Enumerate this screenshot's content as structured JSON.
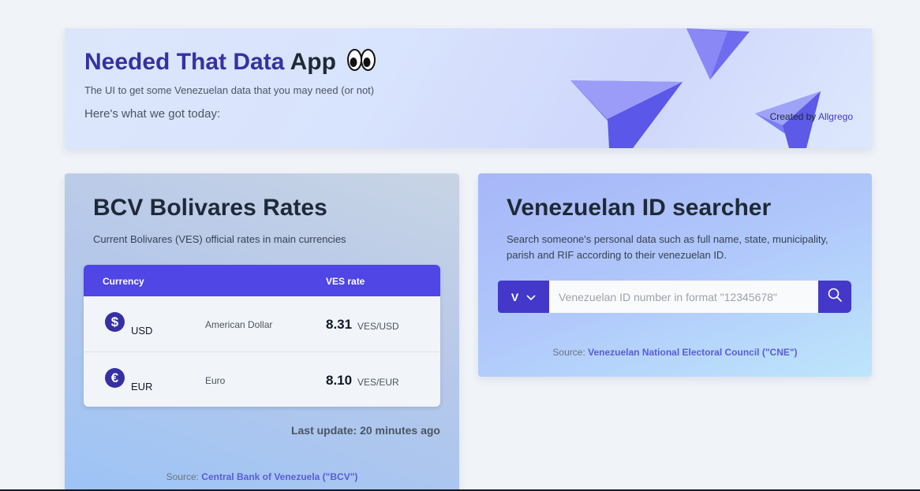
{
  "header": {
    "title_accent": "Needed That Data",
    "title_plain": "App",
    "subtitle": "The UI to get some Venezuelan data that you may need (or not)",
    "today": "Here's what we got today:",
    "credit_prefix": "Created by",
    "credit_link": "Allgrego"
  },
  "bcv": {
    "title": "BCV Bolivares Rates",
    "description": "Current Bolivares (VES) official rates in main currencies",
    "table": {
      "col_currency": "Currency",
      "col_rate": "VES rate",
      "rows": [
        {
          "symbol": "$",
          "code": "USD",
          "name": "American Dollar",
          "rate": "8.31",
          "unit": "VES/USD"
        },
        {
          "symbol": "€",
          "code": "EUR",
          "name": "Euro",
          "rate": "8.10",
          "unit": "VES/EUR"
        }
      ]
    },
    "last_update": "Last update: 20 minutes ago",
    "source_prefix": "Source:",
    "source_link": "Central Bank of Venezuela (\"BCV\")"
  },
  "id_search": {
    "title": "Venezuelan ID searcher",
    "description": "Search someone's personal data such as full name, state, municipality, parish and RIF according to their venezuelan ID.",
    "prefix_value": "V",
    "input_placeholder": "Venezuelan ID number in format \"12345678\"",
    "input_value": "",
    "source_prefix": "Source:",
    "source_link": "Venezuelan National Electoral Council (\"CNE\")"
  },
  "colors": {
    "accent": "#4338ca",
    "table_header": "#4f46e5",
    "title_accent": "#3730a3"
  }
}
